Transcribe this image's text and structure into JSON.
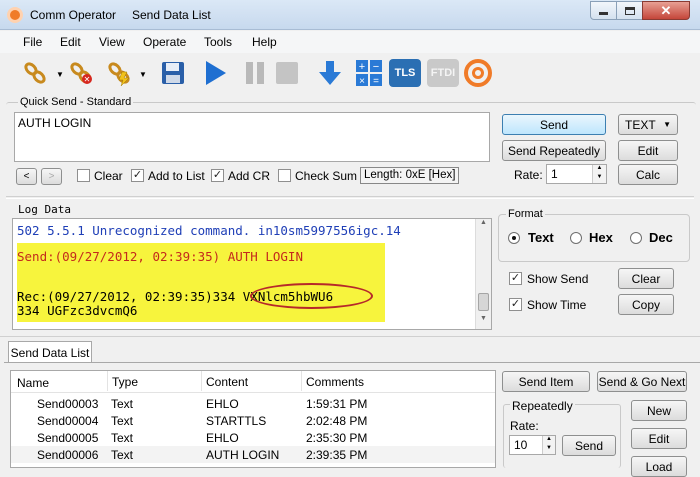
{
  "window": {
    "title": "Comm Operator",
    "subtitle": "Send Data List"
  },
  "menu": [
    "File",
    "Edit",
    "View",
    "Operate",
    "Tools",
    "Help"
  ],
  "toolbar": {
    "tls_label": "TLS",
    "ftdi_label": "FTDI"
  },
  "quick_send": {
    "title": "Quick Send - Standard",
    "text": "AUTH LOGIN",
    "send": "Send",
    "send_repeatedly": "Send Repeatedly",
    "format_value": "TEXT",
    "edit": "Edit",
    "rate_label": "Rate:",
    "rate_value": "1",
    "calc": "Calc",
    "nav_prev": "<",
    "nav_next": ">",
    "clear": "Clear",
    "add_to_list": "Add to List",
    "add_cr": "Add CR",
    "check_sum": "Check Sum",
    "length": "Length: 0xE [Hex]"
  },
  "log": {
    "title": "Log Data",
    "line1": "502 5.5.1 Unrecognized command. in10sm5997556igc.14",
    "line2": "Send:(09/27/2012, 02:39:35) AUTH LOGIN",
    "line3_prefix": "Rec:(09/27/2012, 02:39:35)334 ",
    "line3_token": "VXNlcm5hbWU6",
    "line4": "334 UGFzc3dvcmQ6"
  },
  "format": {
    "title": "Format",
    "text": "Text",
    "hex": "Hex",
    "dec": "Dec",
    "show_send": "Show Send",
    "show_time": "Show Time",
    "clear": "Clear",
    "copy": "Copy"
  },
  "send_list": {
    "tab": "Send Data List",
    "headers": [
      "Name",
      "Type",
      "Content",
      "Comments"
    ],
    "rows": [
      [
        "Send00003",
        "Text",
        "EHLO",
        "1:59:31 PM"
      ],
      [
        "Send00004",
        "Text",
        "STARTTLS",
        "2:02:48 PM"
      ],
      [
        "Send00005",
        "Text",
        "EHLO",
        "2:35:30 PM"
      ],
      [
        "Send00006",
        "Text",
        "AUTH LOGIN",
        "2:39:35 PM"
      ]
    ],
    "send_item": "Send Item",
    "send_go_next": "Send & Go Next",
    "repeatedly": "Repeatedly",
    "rate_label": "Rate:",
    "rate_value": "10",
    "send": "Send",
    "new": "New",
    "edit": "Edit",
    "load": "Load"
  }
}
